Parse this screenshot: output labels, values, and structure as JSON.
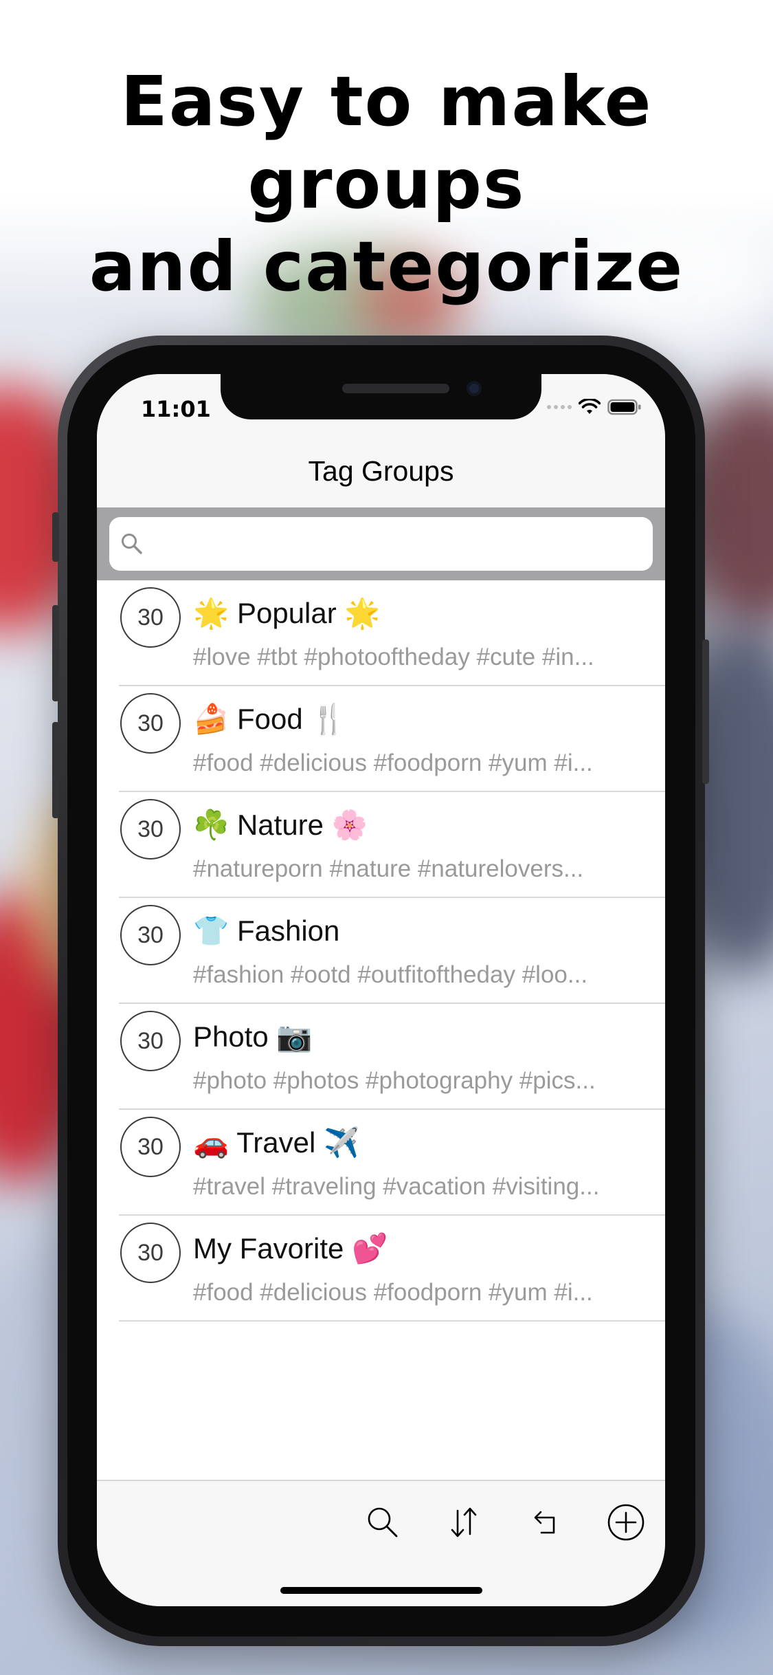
{
  "headline": {
    "line1": "Easy to make groups",
    "line2": "and categorize"
  },
  "status_bar": {
    "time": "11:01",
    "icons": [
      "signal-dots-icon",
      "wifi-icon",
      "battery-icon"
    ]
  },
  "nav": {
    "title": "Tag Groups"
  },
  "search": {
    "placeholder": "",
    "value": ""
  },
  "groups": [
    {
      "count": "30",
      "title": "🌟 Popular 🌟",
      "tags": "#love #tbt #photooftheday #cute #in..."
    },
    {
      "count": "30",
      "title": "🍰 Food 🍴",
      "tags": "#food #delicious #foodporn #yum #i..."
    },
    {
      "count": "30",
      "title": "☘️ Nature 🌸",
      "tags": "#natureporn #nature #naturelovers..."
    },
    {
      "count": "30",
      "title": "👕 Fashion",
      "tags": "#fashion #ootd #outfitoftheday #loo..."
    },
    {
      "count": "30",
      "title": "Photo 📷",
      "tags": "#photo #photos #photography #pics..."
    },
    {
      "count": "30",
      "title": "🚗 Travel ✈️",
      "tags": "#travel #traveling #vacation #visiting..."
    },
    {
      "count": "30",
      "title": "My Favorite 💕",
      "tags": "#food #delicious #foodporn #yum #i..."
    }
  ],
  "toolbar": {
    "icons": [
      "search-icon",
      "sort-icon",
      "undo-icon",
      "add-icon"
    ]
  },
  "colors": {
    "accent": "#000000",
    "tag_gray": "#9a9a9a",
    "search_bar_bg": "#a4a4a6"
  }
}
